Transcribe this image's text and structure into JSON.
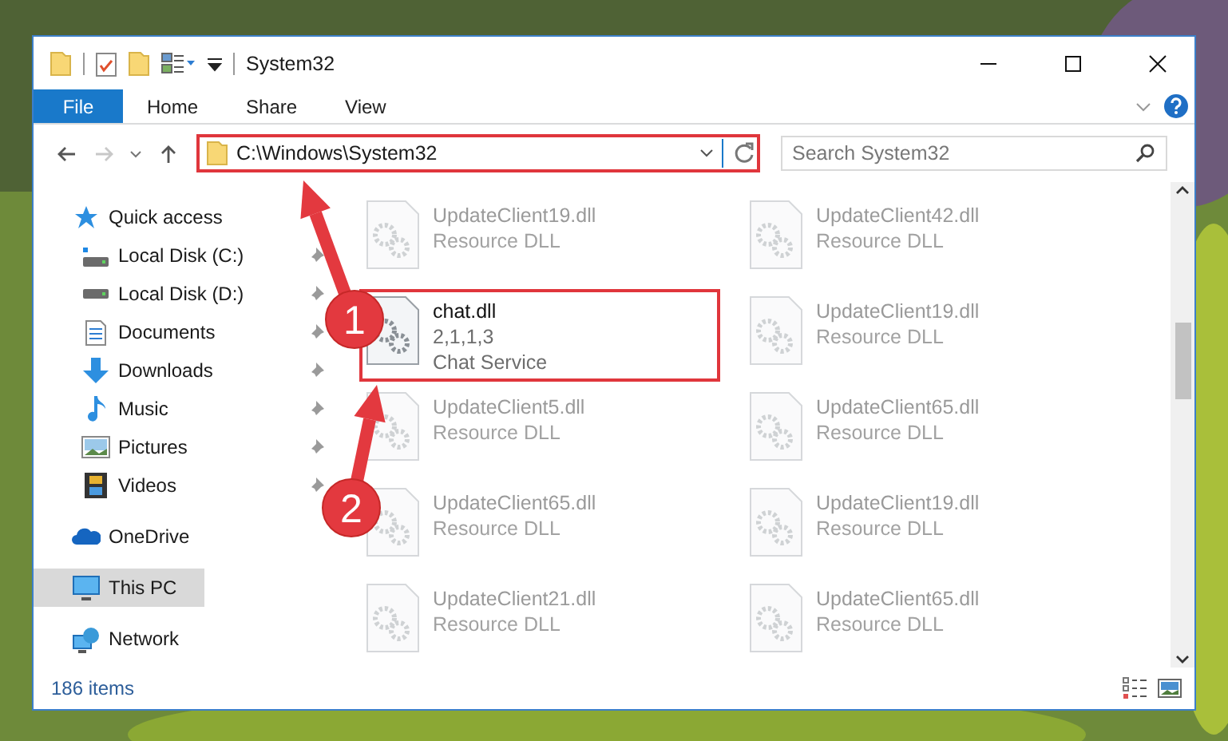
{
  "window": {
    "title": "System32"
  },
  "ribbon": {
    "tabs": [
      {
        "label": "File",
        "kind": "file"
      },
      {
        "label": "Home",
        "kind": "tab"
      },
      {
        "label": "Share",
        "kind": "tab"
      },
      {
        "label": "View",
        "kind": "tab"
      }
    ]
  },
  "address_bar": {
    "path": "C:\\Windows\\System32",
    "highlighted": true
  },
  "search": {
    "placeholder": "Search System32"
  },
  "sidebar": {
    "items": [
      {
        "label": "Quick access",
        "selected": false,
        "children": [
          {
            "label": "Local Disk (C:)",
            "pinned": true,
            "selected": false
          },
          {
            "label": "Local Disk (D:)",
            "pinned": true,
            "selected": false
          },
          {
            "label": "Documents",
            "pinned": true,
            "selected": false
          },
          {
            "label": "Downloads",
            "pinned": true,
            "selected": false
          },
          {
            "label": "Music",
            "pinned": true,
            "selected": false
          },
          {
            "label": "Pictures",
            "pinned": true,
            "selected": false
          },
          {
            "label": "Videos",
            "pinned": true,
            "selected": false
          }
        ]
      },
      {
        "label": "OneDrive",
        "selected": false
      },
      {
        "label": "This PC",
        "selected": true
      },
      {
        "label": "Network",
        "selected": false
      }
    ]
  },
  "files": [
    {
      "name": "UpdateClient19.dll",
      "details": [
        "Resource DLL"
      ],
      "dimmed": true,
      "highlighted": false
    },
    {
      "name": "UpdateClient42.dll",
      "details": [
        "Resource DLL"
      ],
      "dimmed": true,
      "highlighted": false
    },
    {
      "name": "chat.dll",
      "details": [
        "2,1,1,3",
        "Chat Service"
      ],
      "dimmed": false,
      "highlighted": true
    },
    {
      "name": "UpdateClient19.dll",
      "details": [
        "Resource DLL"
      ],
      "dimmed": true,
      "highlighted": false
    },
    {
      "name": "UpdateClient5.dll",
      "details": [
        "Resource DLL"
      ],
      "dimmed": true,
      "highlighted": false
    },
    {
      "name": "UpdateClient65.dll",
      "details": [
        "Resource DLL"
      ],
      "dimmed": true,
      "highlighted": false
    },
    {
      "name": "UpdateClient65.dll",
      "details": [
        "Resource DLL"
      ],
      "dimmed": true,
      "highlighted": false
    },
    {
      "name": "UpdateClient19.dll",
      "details": [
        "Resource DLL"
      ],
      "dimmed": true,
      "highlighted": false
    },
    {
      "name": "UpdateClient21.dll",
      "details": [
        "Resource DLL"
      ],
      "dimmed": true,
      "highlighted": false
    },
    {
      "name": "UpdateClient65.dll",
      "details": [
        "Resource DLL"
      ],
      "dimmed": true,
      "highlighted": false
    }
  ],
  "status_bar": {
    "item_count": "186 items"
  },
  "callouts": [
    {
      "label": "1"
    },
    {
      "label": "2"
    }
  ]
}
